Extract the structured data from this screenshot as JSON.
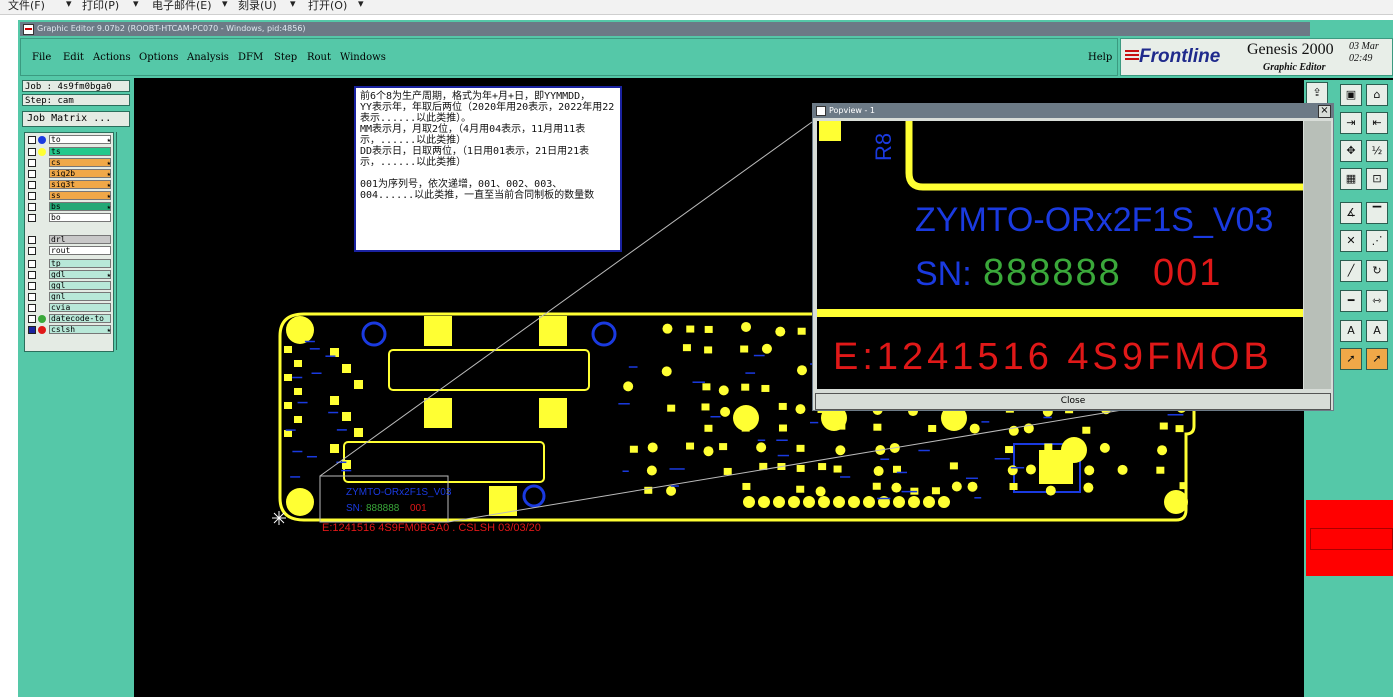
{
  "host_menu": [
    "文件(F)",
    "打印(P)",
    "电子邮件(E)",
    "刻录(U)",
    "打开(O)"
  ],
  "window_title": "Graphic Editor 9.07b2 (ROOBT-HTCAM-PC070 - Windows, pid:4856)",
  "menu": [
    "File",
    "Edit",
    "Actions",
    "Options",
    "Analysis",
    "DFM",
    "Step",
    "Rout",
    "Windows"
  ],
  "help_label": "Help",
  "brand": {
    "logo": "Frontline",
    "product": "Genesis 2000",
    "subtitle": "Graphic Editor",
    "date_line1": "03 Mar",
    "time_line": "02:49"
  },
  "job": {
    "job_label": "Job : 4s9fm0bga0",
    "step_label": "Step: cam",
    "matrix_button": "Job Matrix ..."
  },
  "layers": [
    {
      "name": "to",
      "color": "#1a3ae0",
      "bg": "#ffffff",
      "mark": "★"
    },
    {
      "name": "ts",
      "color": "#ffff33",
      "bg": "#24c88c",
      "mark": ""
    },
    {
      "name": "cs",
      "color": "",
      "bg": "#f0a848",
      "mark": "★"
    },
    {
      "name": "sig2b",
      "color": "",
      "bg": "#f0a848",
      "mark": "★"
    },
    {
      "name": "sig3t",
      "color": "",
      "bg": "#f0a848",
      "mark": "★"
    },
    {
      "name": "ss",
      "color": "",
      "bg": "#f0a848",
      "mark": "★"
    },
    {
      "name": "bs",
      "color": "",
      "bg": "#24a876",
      "mark": "★"
    },
    {
      "name": "bo",
      "color": "",
      "bg": "#ffffff",
      "mark": ""
    },
    {
      "name": "drl",
      "color": "",
      "bg": "#c8c8c8",
      "mark": ""
    },
    {
      "name": "rout",
      "color": "",
      "bg": "#ffffff",
      "mark": ""
    },
    {
      "name": "tp",
      "color": "",
      "bg": "#b8e8d8",
      "mark": ""
    },
    {
      "name": "gdl",
      "color": "",
      "bg": "#b8e8d8",
      "mark": "★"
    },
    {
      "name": "ggl",
      "color": "",
      "bg": "#b8e8d8",
      "mark": ""
    },
    {
      "name": "gnl",
      "color": "",
      "bg": "#b8e8d8",
      "mark": ""
    },
    {
      "name": "cvia",
      "color": "",
      "bg": "#b8e8d8",
      "mark": ""
    },
    {
      "name": "datecode-to",
      "color": "#3aa83a",
      "bg": "#b8e8d8",
      "mark": ""
    },
    {
      "name": "cslsh",
      "color": "#e01818",
      "bg": "#b8e8d8",
      "mark": "★"
    }
  ],
  "note": {
    "para1": "前6个8为生产周期，格式为年+月+日，即YYMMDD，\nYY表示年，年取后两位（2020年用20表示，2022年用22表示......以此类推）。\nMM表示月，月取2位，（4月用04表示，11月用11表示，......以此类推）\nDD表示日，日取两位，（1日用01表示，21日用21表示，......以此类推）",
    "para2": "001为序列号，依次递增，001、002、003、004......以此类推，一直至当前合同制板的数量数"
  },
  "board": {
    "silk_name": "ZYMTO-ORx2F1S_V03",
    "sn_label": "SN:",
    "sn_date": "888888",
    "sn_seq": "001",
    "code_line": "E:1241516 4S9FM0BGA0 . CSLSH 03/03/20"
  },
  "popview": {
    "title": "Popview - 1",
    "ref": "R8",
    "silk_name": "ZYMTO-ORx2F1S_V03",
    "sn_label": "SN:",
    "sn_date": "888888",
    "sn_seq": "001",
    "code_line": "E:1241516 4S9FMOB",
    "close_label": "Close"
  },
  "colors": {
    "board_yellow": "#ffff33",
    "silk_blue": "#1a3ae0",
    "sn_green": "#3aa83a",
    "code_red": "#e01818",
    "panel_teal": "#55c8a8"
  }
}
